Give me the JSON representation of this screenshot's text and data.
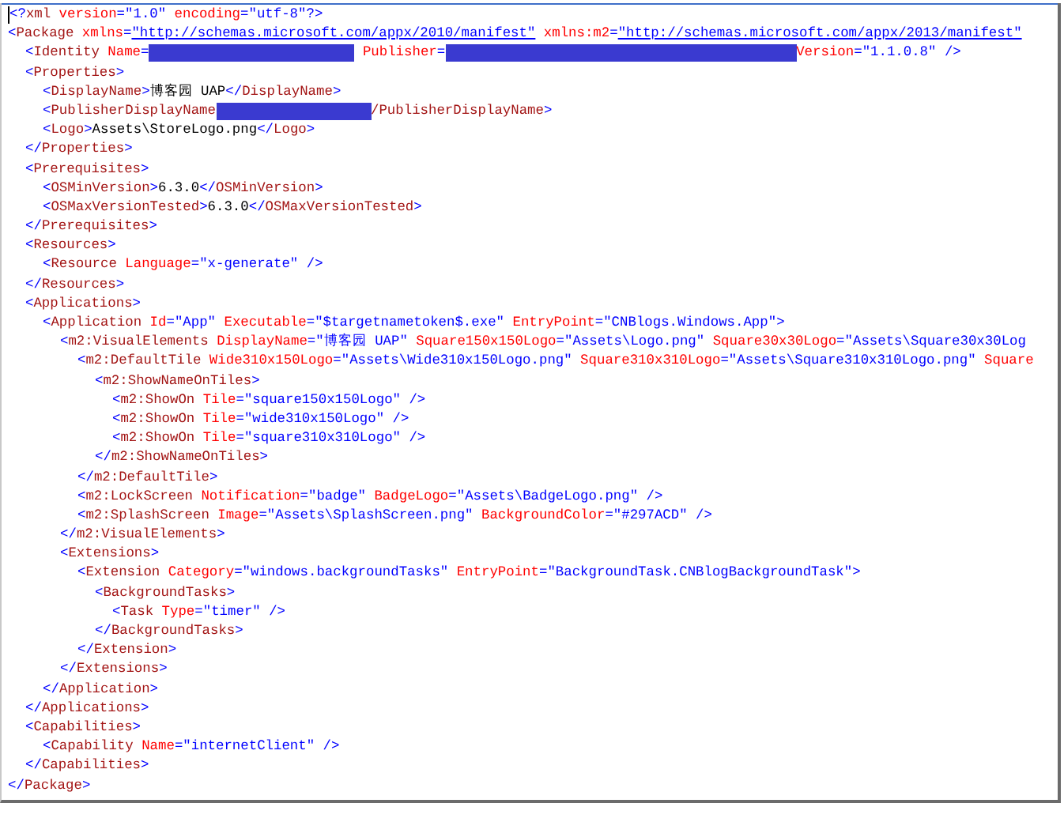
{
  "editor": {
    "lines": [
      {
        "tokens": [
          {
            "kind": "punct",
            "text": "<?"
          },
          {
            "kind": "tag",
            "text": "xml"
          },
          {
            "kind": "attr",
            "text": " version"
          },
          {
            "kind": "punct",
            "text": "="
          },
          {
            "kind": "value",
            "text": "\"1.0\""
          },
          {
            "kind": "attr",
            "text": " encoding"
          },
          {
            "kind": "punct",
            "text": "="
          },
          {
            "kind": "value",
            "text": "\"utf-8\""
          },
          {
            "kind": "punct",
            "text": "?>"
          }
        ]
      },
      {
        "tokens": [
          {
            "kind": "punct",
            "text": "<"
          },
          {
            "kind": "tag",
            "text": "Package"
          },
          {
            "kind": "attr",
            "text": " xmlns"
          },
          {
            "kind": "punct",
            "text": "="
          },
          {
            "kind": "link",
            "text": "\"http://schemas.microsoft.com/appx/2010/manifest\""
          },
          {
            "kind": "attr",
            "text": " xmlns:m2"
          },
          {
            "kind": "punct",
            "text": "="
          },
          {
            "kind": "link",
            "text": "\"http://schemas.microsoft.com/appx/2013/manifest\""
          }
        ],
        "children": [
          {
            "tokens": [
              {
                "kind": "punct",
                "text": "<"
              },
              {
                "kind": "tag",
                "text": "Identity"
              },
              {
                "kind": "attr",
                "text": " Name"
              },
              {
                "kind": "punct",
                "text": "="
              },
              {
                "kind": "redaction"
              },
              {
                "kind": "attr",
                "text": " Publisher"
              },
              {
                "kind": "punct",
                "text": "="
              },
              {
                "kind": "redaction"
              },
              {
                "kind": "attr",
                "text": "Version"
              },
              {
                "kind": "punct",
                "text": "="
              },
              {
                "kind": "value",
                "text": "\"1.1.0.8\""
              },
              {
                "kind": "punct",
                "text": " />"
              }
            ]
          },
          {
            "tokens": [
              {
                "kind": "punct",
                "text": "<"
              },
              {
                "kind": "tag",
                "text": "Properties"
              },
              {
                "kind": "punct",
                "text": ">"
              }
            ],
            "children": [
              {
                "tokens": [
                  {
                    "kind": "punct",
                    "text": "<"
                  },
                  {
                    "kind": "tag",
                    "text": "DisplayName"
                  },
                  {
                    "kind": "punct",
                    "text": ">"
                  },
                  {
                    "kind": "text",
                    "text": "博客园 UAP"
                  },
                  {
                    "kind": "punct",
                    "text": "</"
                  },
                  {
                    "kind": "tag",
                    "text": "DisplayName"
                  },
                  {
                    "kind": "punct",
                    "text": ">"
                  }
                ]
              },
              {
                "tokens": [
                  {
                    "kind": "punct",
                    "text": "<"
                  },
                  {
                    "kind": "tag",
                    "text": "PublisherDisplayName"
                  },
                  {
                    "kind": "redaction"
                  },
                  {
                    "kind": "tag",
                    "text": "/PublisherDisplayName"
                  },
                  {
                    "kind": "punct",
                    "text": ">"
                  }
                ]
              },
              {
                "tokens": [
                  {
                    "kind": "punct",
                    "text": "<"
                  },
                  {
                    "kind": "tag",
                    "text": "Logo"
                  },
                  {
                    "kind": "punct",
                    "text": ">"
                  },
                  {
                    "kind": "text",
                    "text": "Assets\\StoreLogo.png"
                  },
                  {
                    "kind": "punct",
                    "text": "</"
                  },
                  {
                    "kind": "tag",
                    "text": "Logo"
                  },
                  {
                    "kind": "punct",
                    "text": ">"
                  }
                ]
              }
            ]
          },
          {
            "tokens": [
              {
                "kind": "punct",
                "text": "</"
              },
              {
                "kind": "tag",
                "text": "Properties"
              },
              {
                "kind": "punct",
                "text": ">"
              }
            ]
          },
          {
            "tokens": [
              {
                "kind": "punct",
                "text": "<"
              },
              {
                "kind": "tag",
                "text": "Prerequisites"
              },
              {
                "kind": "punct",
                "text": ">"
              }
            ],
            "children": [
              {
                "tokens": [
                  {
                    "kind": "punct",
                    "text": "<"
                  },
                  {
                    "kind": "tag",
                    "text": "OSMinVersion"
                  },
                  {
                    "kind": "punct",
                    "text": ">"
                  },
                  {
                    "kind": "text",
                    "text": "6.3.0"
                  },
                  {
                    "kind": "punct",
                    "text": "</"
                  },
                  {
                    "kind": "tag",
                    "text": "OSMinVersion"
                  },
                  {
                    "kind": "punct",
                    "text": ">"
                  }
                ]
              },
              {
                "tokens": [
                  {
                    "kind": "punct",
                    "text": "<"
                  },
                  {
                    "kind": "tag",
                    "text": "OSMaxVersionTested"
                  },
                  {
                    "kind": "punct",
                    "text": ">"
                  },
                  {
                    "kind": "text",
                    "text": "6.3.0"
                  },
                  {
                    "kind": "punct",
                    "text": "</"
                  },
                  {
                    "kind": "tag",
                    "text": "OSMaxVersionTested"
                  },
                  {
                    "kind": "punct",
                    "text": ">"
                  }
                ]
              }
            ]
          },
          {
            "tokens": [
              {
                "kind": "punct",
                "text": "</"
              },
              {
                "kind": "tag",
                "text": "Prerequisites"
              },
              {
                "kind": "punct",
                "text": ">"
              }
            ]
          },
          {
            "tokens": [
              {
                "kind": "punct",
                "text": "<"
              },
              {
                "kind": "tag",
                "text": "Resources"
              },
              {
                "kind": "punct",
                "text": ">"
              }
            ],
            "children": [
              {
                "tokens": [
                  {
                    "kind": "punct",
                    "text": "<"
                  },
                  {
                    "kind": "tag",
                    "text": "Resource"
                  },
                  {
                    "kind": "attr",
                    "text": " Language"
                  },
                  {
                    "kind": "punct",
                    "text": "="
                  },
                  {
                    "kind": "value",
                    "text": "\"x-generate\""
                  },
                  {
                    "kind": "punct",
                    "text": " />"
                  }
                ]
              }
            ]
          },
          {
            "tokens": [
              {
                "kind": "punct",
                "text": "</"
              },
              {
                "kind": "tag",
                "text": "Resources"
              },
              {
                "kind": "punct",
                "text": ">"
              }
            ]
          },
          {
            "tokens": [
              {
                "kind": "punct",
                "text": "<"
              },
              {
                "kind": "tag",
                "text": "Applications"
              },
              {
                "kind": "punct",
                "text": ">"
              }
            ],
            "children": [
              {
                "tokens": [
                  {
                    "kind": "punct",
                    "text": "<"
                  },
                  {
                    "kind": "tag",
                    "text": "Application"
                  },
                  {
                    "kind": "attr",
                    "text": " Id"
                  },
                  {
                    "kind": "punct",
                    "text": "="
                  },
                  {
                    "kind": "value",
                    "text": "\"App\""
                  },
                  {
                    "kind": "attr",
                    "text": " Executable"
                  },
                  {
                    "kind": "punct",
                    "text": "="
                  },
                  {
                    "kind": "value",
                    "text": "\"$targetnametoken$.exe\""
                  },
                  {
                    "kind": "attr",
                    "text": " EntryPoint"
                  },
                  {
                    "kind": "punct",
                    "text": "="
                  },
                  {
                    "kind": "value",
                    "text": "\"CNBlogs.Windows.App\""
                  },
                  {
                    "kind": "punct",
                    "text": ">"
                  }
                ],
                "children": [
                  {
                    "tokens": [
                      {
                        "kind": "punct",
                        "text": "<"
                      },
                      {
                        "kind": "tag",
                        "text": "m2:VisualElements"
                      },
                      {
                        "kind": "attr",
                        "text": " DisplayName"
                      },
                      {
                        "kind": "punct",
                        "text": "="
                      },
                      {
                        "kind": "value",
                        "text": "\"博客园 UAP\""
                      },
                      {
                        "kind": "attr",
                        "text": " Square150x150Logo"
                      },
                      {
                        "kind": "punct",
                        "text": "="
                      },
                      {
                        "kind": "value",
                        "text": "\"Assets\\Logo.png\""
                      },
                      {
                        "kind": "attr",
                        "text": " Square30x30Logo"
                      },
                      {
                        "kind": "punct",
                        "text": "="
                      },
                      {
                        "kind": "value",
                        "text": "\"Assets\\Square30x30Log"
                      }
                    ],
                    "children": [
                      {
                        "tokens": [
                          {
                            "kind": "punct",
                            "text": "<"
                          },
                          {
                            "kind": "tag",
                            "text": "m2:DefaultTile"
                          },
                          {
                            "kind": "attr",
                            "text": " Wide310x150Logo"
                          },
                          {
                            "kind": "punct",
                            "text": "="
                          },
                          {
                            "kind": "value",
                            "text": "\"Assets\\Wide310x150Logo.png\""
                          },
                          {
                            "kind": "attr",
                            "text": " Square310x310Logo"
                          },
                          {
                            "kind": "punct",
                            "text": "="
                          },
                          {
                            "kind": "value",
                            "text": "\"Assets\\Square310x310Logo.png\""
                          },
                          {
                            "kind": "attr",
                            "text": " Square"
                          }
                        ],
                        "children": [
                          {
                            "tokens": [
                              {
                                "kind": "punct",
                                "text": "<"
                              },
                              {
                                "kind": "tag",
                                "text": "m2:ShowNameOnTiles"
                              },
                              {
                                "kind": "punct",
                                "text": ">"
                              }
                            ],
                            "children": [
                              {
                                "tokens": [
                                  {
                                    "kind": "punct",
                                    "text": "<"
                                  },
                                  {
                                    "kind": "tag",
                                    "text": "m2:ShowOn"
                                  },
                                  {
                                    "kind": "attr",
                                    "text": " Tile"
                                  },
                                  {
                                    "kind": "punct",
                                    "text": "="
                                  },
                                  {
                                    "kind": "value",
                                    "text": "\"square150x150Logo\""
                                  },
                                  {
                                    "kind": "punct",
                                    "text": " />"
                                  }
                                ]
                              },
                              {
                                "tokens": [
                                  {
                                    "kind": "punct",
                                    "text": "<"
                                  },
                                  {
                                    "kind": "tag",
                                    "text": "m2:ShowOn"
                                  },
                                  {
                                    "kind": "attr",
                                    "text": " Tile"
                                  },
                                  {
                                    "kind": "punct",
                                    "text": "="
                                  },
                                  {
                                    "kind": "value",
                                    "text": "\"wide310x150Logo\""
                                  },
                                  {
                                    "kind": "punct",
                                    "text": " />"
                                  }
                                ]
                              },
                              {
                                "tokens": [
                                  {
                                    "kind": "punct",
                                    "text": "<"
                                  },
                                  {
                                    "kind": "tag",
                                    "text": "m2:ShowOn"
                                  },
                                  {
                                    "kind": "attr",
                                    "text": " Tile"
                                  },
                                  {
                                    "kind": "punct",
                                    "text": "="
                                  },
                                  {
                                    "kind": "value",
                                    "text": "\"square310x310Logo\""
                                  },
                                  {
                                    "kind": "punct",
                                    "text": " />"
                                  }
                                ]
                              }
                            ]
                          },
                          {
                            "tokens": [
                              {
                                "kind": "punct",
                                "text": "</"
                              },
                              {
                                "kind": "tag",
                                "text": "m2:ShowNameOnTiles"
                              },
                              {
                                "kind": "punct",
                                "text": ">"
                              }
                            ]
                          }
                        ]
                      },
                      {
                        "tokens": [
                          {
                            "kind": "punct",
                            "text": "</"
                          },
                          {
                            "kind": "tag",
                            "text": "m2:DefaultTile"
                          },
                          {
                            "kind": "punct",
                            "text": ">"
                          }
                        ]
                      },
                      {
                        "tokens": [
                          {
                            "kind": "punct",
                            "text": "<"
                          },
                          {
                            "kind": "tag",
                            "text": "m2:LockScreen"
                          },
                          {
                            "kind": "attr",
                            "text": " Notification"
                          },
                          {
                            "kind": "punct",
                            "text": "="
                          },
                          {
                            "kind": "value",
                            "text": "\"badge\""
                          },
                          {
                            "kind": "attr",
                            "text": " BadgeLogo"
                          },
                          {
                            "kind": "punct",
                            "text": "="
                          },
                          {
                            "kind": "value",
                            "text": "\"Assets\\BadgeLogo.png\""
                          },
                          {
                            "kind": "punct",
                            "text": " />"
                          }
                        ]
                      },
                      {
                        "tokens": [
                          {
                            "kind": "punct",
                            "text": "<"
                          },
                          {
                            "kind": "tag",
                            "text": "m2:SplashScreen"
                          },
                          {
                            "kind": "attr",
                            "text": " Image"
                          },
                          {
                            "kind": "punct",
                            "text": "="
                          },
                          {
                            "kind": "value",
                            "text": "\"Assets\\SplashScreen.png\""
                          },
                          {
                            "kind": "attr",
                            "text": " BackgroundColor"
                          },
                          {
                            "kind": "punct",
                            "text": "="
                          },
                          {
                            "kind": "value",
                            "text": "\"#297ACD\""
                          },
                          {
                            "kind": "punct",
                            "text": " />"
                          }
                        ]
                      }
                    ]
                  },
                  {
                    "tokens": [
                      {
                        "kind": "punct",
                        "text": "</"
                      },
                      {
                        "kind": "tag",
                        "text": "m2:VisualElements"
                      },
                      {
                        "kind": "punct",
                        "text": ">"
                      }
                    ]
                  },
                  {
                    "tokens": [
                      {
                        "kind": "punct",
                        "text": "<"
                      },
                      {
                        "kind": "tag",
                        "text": "Extensions"
                      },
                      {
                        "kind": "punct",
                        "text": ">"
                      }
                    ],
                    "children": [
                      {
                        "tokens": [
                          {
                            "kind": "punct",
                            "text": "<"
                          },
                          {
                            "kind": "tag",
                            "text": "Extension"
                          },
                          {
                            "kind": "attr",
                            "text": " Category"
                          },
                          {
                            "kind": "punct",
                            "text": "="
                          },
                          {
                            "kind": "value",
                            "text": "\"windows.backgroundTasks\""
                          },
                          {
                            "kind": "attr",
                            "text": " EntryPoint"
                          },
                          {
                            "kind": "punct",
                            "text": "="
                          },
                          {
                            "kind": "value",
                            "text": "\"BackgroundTask.CNBlogBackgroundTask\""
                          },
                          {
                            "kind": "punct",
                            "text": ">"
                          }
                        ],
                        "children": [
                          {
                            "tokens": [
                              {
                                "kind": "punct",
                                "text": "<"
                              },
                              {
                                "kind": "tag",
                                "text": "BackgroundTasks"
                              },
                              {
                                "kind": "punct",
                                "text": ">"
                              }
                            ],
                            "children": [
                              {
                                "tokens": [
                                  {
                                    "kind": "punct",
                                    "text": "<"
                                  },
                                  {
                                    "kind": "tag",
                                    "text": "Task"
                                  },
                                  {
                                    "kind": "attr",
                                    "text": " Type"
                                  },
                                  {
                                    "kind": "punct",
                                    "text": "="
                                  },
                                  {
                                    "kind": "value",
                                    "text": "\"timer\""
                                  },
                                  {
                                    "kind": "punct",
                                    "text": " />"
                                  }
                                ]
                              }
                            ]
                          },
                          {
                            "tokens": [
                              {
                                "kind": "punct",
                                "text": "</"
                              },
                              {
                                "kind": "tag",
                                "text": "BackgroundTasks"
                              },
                              {
                                "kind": "punct",
                                "text": ">"
                              }
                            ]
                          }
                        ]
                      },
                      {
                        "tokens": [
                          {
                            "kind": "punct",
                            "text": "</"
                          },
                          {
                            "kind": "tag",
                            "text": "Extension"
                          },
                          {
                            "kind": "punct",
                            "text": ">"
                          }
                        ]
                      }
                    ]
                  },
                  {
                    "tokens": [
                      {
                        "kind": "punct",
                        "text": "</"
                      },
                      {
                        "kind": "tag",
                        "text": "Extensions"
                      },
                      {
                        "kind": "punct",
                        "text": ">"
                      }
                    ]
                  }
                ]
              },
              {
                "tokens": [
                  {
                    "kind": "punct",
                    "text": "</"
                  },
                  {
                    "kind": "tag",
                    "text": "Application"
                  },
                  {
                    "kind": "punct",
                    "text": ">"
                  }
                ]
              }
            ]
          },
          {
            "tokens": [
              {
                "kind": "punct",
                "text": "</"
              },
              {
                "kind": "tag",
                "text": "Applications"
              },
              {
                "kind": "punct",
                "text": ">"
              }
            ]
          },
          {
            "tokens": [
              {
                "kind": "punct",
                "text": "<"
              },
              {
                "kind": "tag",
                "text": "Capabilities"
              },
              {
                "kind": "punct",
                "text": ">"
              }
            ],
            "children": [
              {
                "tokens": [
                  {
                    "kind": "punct",
                    "text": "<"
                  },
                  {
                    "kind": "tag",
                    "text": "Capability"
                  },
                  {
                    "kind": "attr",
                    "text": " Name"
                  },
                  {
                    "kind": "punct",
                    "text": "="
                  },
                  {
                    "kind": "value",
                    "text": "\"internetClient\""
                  },
                  {
                    "kind": "punct",
                    "text": " />"
                  }
                ]
              }
            ]
          },
          {
            "tokens": [
              {
                "kind": "punct",
                "text": "</"
              },
              {
                "kind": "tag",
                "text": "Capabilities"
              },
              {
                "kind": "punct",
                "text": ">"
              }
            ]
          }
        ]
      },
      {
        "tokens": [
          {
            "kind": "punct",
            "text": "</"
          },
          {
            "kind": "tag",
            "text": "Package"
          },
          {
            "kind": "punct",
            "text": ">"
          }
        ]
      }
    ]
  }
}
